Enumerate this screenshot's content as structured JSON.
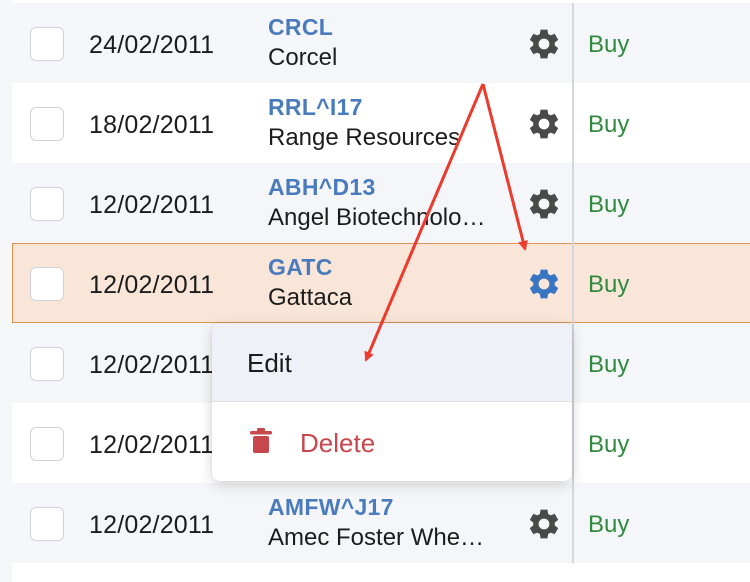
{
  "rows": [
    {
      "date": "24/02/2011",
      "symbol": "CRCL",
      "company": "Corcel",
      "action": "Buy"
    },
    {
      "date": "18/02/2011",
      "symbol": "RRL^I17",
      "company": "Range Resources",
      "action": "Buy"
    },
    {
      "date": "12/02/2011",
      "symbol": "ABH^D13",
      "company": "Angel Biotechnolo…",
      "action": "Buy"
    },
    {
      "date": "12/02/2011",
      "symbol": "GATC",
      "company": "Gattaca",
      "action": "Buy"
    },
    {
      "date": "12/02/2011",
      "symbol": "",
      "company": "",
      "action": "Buy"
    },
    {
      "date": "12/02/2011",
      "symbol": "",
      "company": "",
      "action": "Buy"
    },
    {
      "date": "12/02/2011",
      "symbol": "AMFW^J17",
      "company": "Amec Foster Whe…",
      "action": "Buy"
    }
  ],
  "selected_row_index": 3,
  "menu": {
    "edit_label": "Edit",
    "delete_label": "Delete"
  },
  "icons": {
    "row_menu": "gear-icon",
    "delete": "trash-icon"
  },
  "colors": {
    "symbol": "#4a7bbd",
    "buy": "#2f8a3e",
    "delete": "#c8474d",
    "selected_row_bg": "#f9e6d9",
    "selected_row_border": "#e4924f",
    "active_gear": "#3a75c4",
    "gear": "#4a4a4a",
    "annotation_arrow": "#ec3a2c"
  }
}
